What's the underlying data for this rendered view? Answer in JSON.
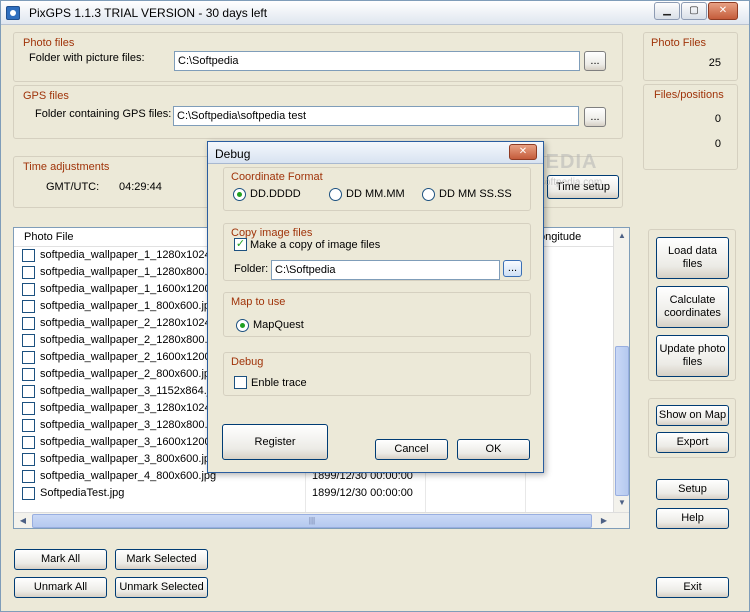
{
  "window": {
    "title": "PixGPS 1.1.3   TRIAL VERSION - 30 days left",
    "min_glyph": "▁",
    "max_glyph": "▢",
    "close_glyph": "✕"
  },
  "photo_files": {
    "group_title": "Photo files",
    "label": "Folder with picture files:",
    "value": "C:\\Softpedia",
    "browse": "..."
  },
  "gps_files": {
    "group_title": "GPS files",
    "label": "Folder containing GPS files:",
    "value": "C:\\Softpedia\\softpedia test",
    "browse": "..."
  },
  "time_adjustments": {
    "group_title": "Time adjustments",
    "label": "GMT/UTC:",
    "value": "04:29:44",
    "setup_button": "Time setup"
  },
  "stats": {
    "photo_files_title": "Photo Files",
    "photo_files_count": "25",
    "files_positions_title": "Files/positions",
    "files_value": "0",
    "positions_value": "0"
  },
  "list": {
    "columns": [
      "Photo File",
      "",
      "",
      "ongitude"
    ],
    "rows": [
      {
        "file": "softpedia_wallpaper_1_1280x1024.jpg",
        "date": ""
      },
      {
        "file": "softpedia_wallpaper_1_1280x800.jpg",
        "date": ""
      },
      {
        "file": "softpedia_wallpaper_1_1600x1200.jpg",
        "date": ""
      },
      {
        "file": "softpedia_wallpaper_1_800x600.jpg",
        "date": ""
      },
      {
        "file": "softpedia_wallpaper_2_1280x1024.jpg",
        "date": ""
      },
      {
        "file": "softpedia_wallpaper_2_1280x800.jpg",
        "date": ""
      },
      {
        "file": "softpedia_wallpaper_2_1600x1200.jpg",
        "date": ""
      },
      {
        "file": "softpedia_wallpaper_2_800x600.jpg",
        "date": ""
      },
      {
        "file": "softpedia_wallpaper_3_1152x864.jpg",
        "date": ""
      },
      {
        "file": "softpedia_wallpaper_3_1280x1024.jpg",
        "date": ""
      },
      {
        "file": "softpedia_wallpaper_3_1280x800.jpg",
        "date": ""
      },
      {
        "file": "softpedia_wallpaper_3_1600x1200.jpg",
        "date": ""
      },
      {
        "file": "softpedia_wallpaper_3_800x600.jpg",
        "date": ""
      },
      {
        "file": "softpedia_wallpaper_4_800x600.jpg",
        "date": "1899/12/30 00:00:00"
      },
      {
        "file": "SoftpediaTest.jpg",
        "date": "1899/12/30 00:00:00"
      }
    ]
  },
  "side_buttons": {
    "load": "Load data files",
    "calculate": "Calculate coordinates",
    "update": "Update photo files",
    "show_map": "Show on Map",
    "export": "Export",
    "setup": "Setup",
    "help": "Help",
    "exit": "Exit"
  },
  "bottom_buttons": {
    "mark_all": "Mark All",
    "mark_selected": "Mark Selected",
    "unmark_all": "Unmark All",
    "unmark_selected": "Unmark Selected"
  },
  "dialog": {
    "title": "Debug",
    "close_glyph": "✕",
    "coordinate_format": {
      "title": "Coordinate Format",
      "options": [
        "DD.DDDD",
        "DD MM.MM",
        "DD MM SS.SS"
      ],
      "selected": "DD.DDDD"
    },
    "copy_image": {
      "title": "Copy image files",
      "checkbox_label": "Make a copy of image files",
      "checked": true,
      "folder_label": "Folder:",
      "folder_value": "C:\\Softpedia",
      "browse": "..."
    },
    "map": {
      "title": "Map to use",
      "option": "MapQuest"
    },
    "debug": {
      "title": "Debug",
      "checkbox_label": "Enble trace",
      "checked": false
    },
    "register": "Register",
    "cancel": "Cancel",
    "ok": "OK"
  },
  "watermark": {
    "text": "SOFTPEDIA",
    "sub": "www.softpedia.com"
  }
}
